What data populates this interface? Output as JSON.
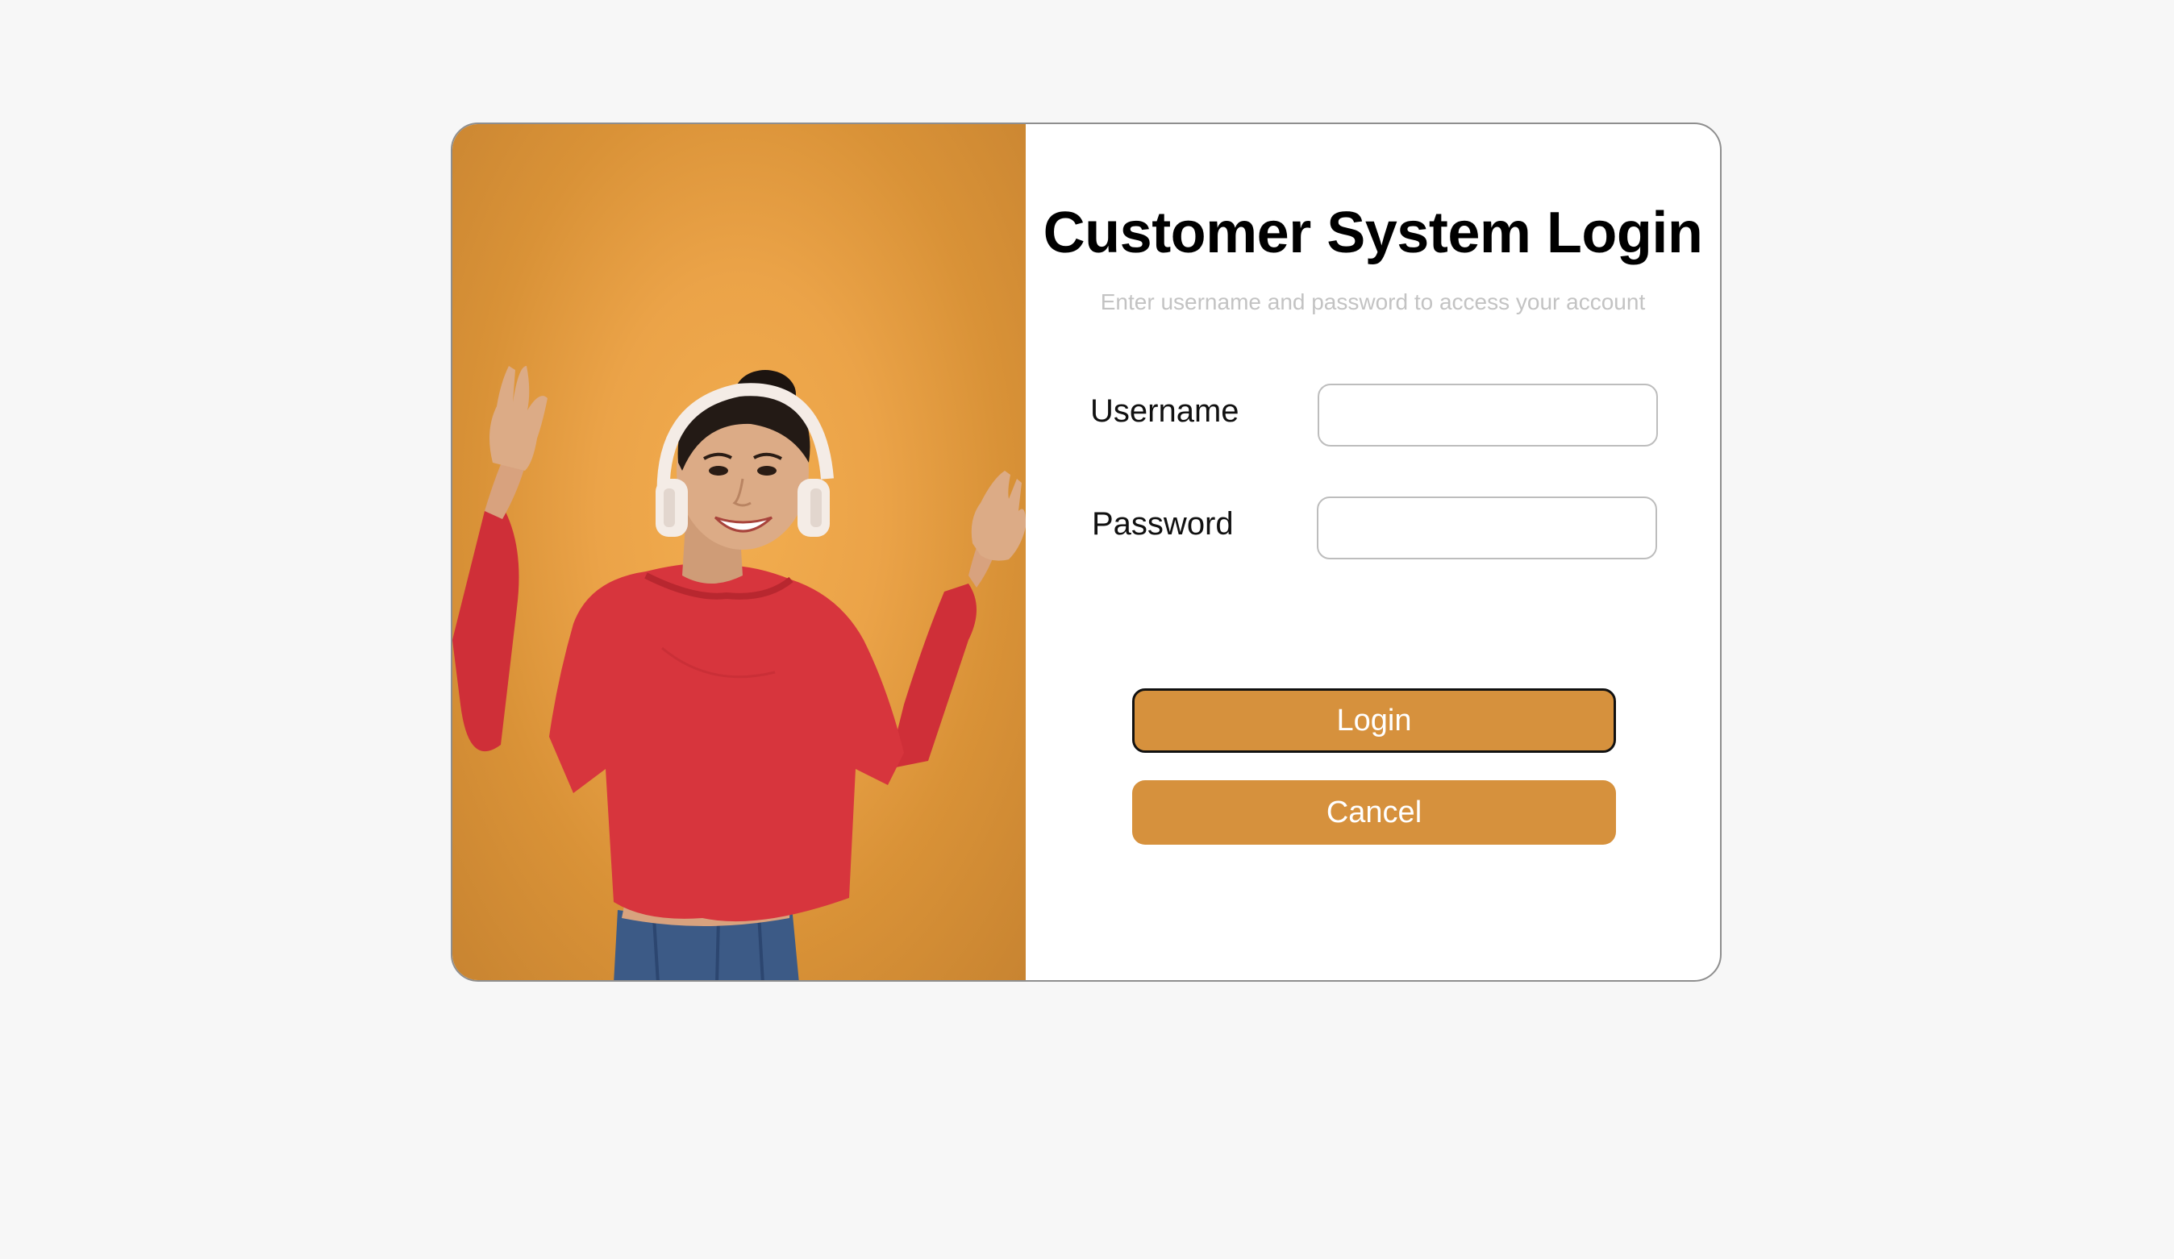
{
  "login_card": {
    "title": "Customer System Login",
    "subtitle": "Enter username and password to access your account",
    "username_label": "Username",
    "username_value": "",
    "password_label": "Password",
    "password_value": "",
    "login_button": "Login",
    "cancel_button": "Cancel"
  },
  "colors": {
    "page_background": "#f7f7f7",
    "accent": "#d6913d",
    "photo_background": "#eba348",
    "title": "#000000",
    "subtitle": "#c3c3c3"
  },
  "photo": {
    "subject": "smiling woman wearing white headphones and red sweater"
  }
}
